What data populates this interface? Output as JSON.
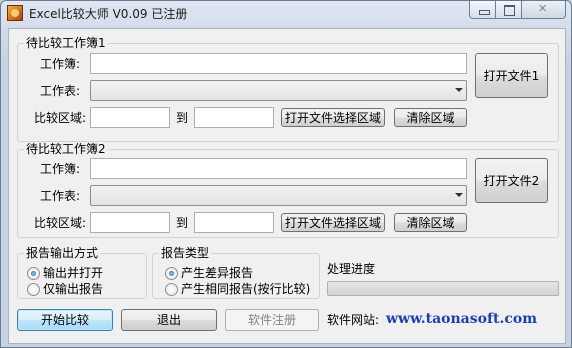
{
  "window": {
    "title": "Excel比较大师 V0.09 已注册"
  },
  "workbook1": {
    "group_label": "待比较工作簿1",
    "workbook_label": "工作簿:",
    "workbook_value": "",
    "sheet_label": "工作表:",
    "sheet_value": "",
    "range_label": "比较区域:",
    "range_from": "",
    "to_label": "到",
    "range_to": "",
    "open_select_range_button": "打开文件选择区域",
    "clear_range_button": "清除区域",
    "open_file_button": "打开文件1"
  },
  "workbook2": {
    "group_label": "待比较工作簿2",
    "workbook_label": "工作簿:",
    "workbook_value": "",
    "sheet_label": "工作表:",
    "sheet_value": "",
    "range_label": "比较区域:",
    "range_from": "",
    "to_label": "到",
    "range_to": "",
    "open_select_range_button": "打开文件选择区域",
    "clear_range_button": "清除区域",
    "open_file_button": "打开文件2"
  },
  "report_output": {
    "group_label": "报告输出方式",
    "options": [
      {
        "label": "输出并打开",
        "selected": true
      },
      {
        "label": "仅输出报告",
        "selected": false
      }
    ]
  },
  "report_type": {
    "group_label": "报告类型",
    "options": [
      {
        "label": "产生差异报告",
        "selected": true
      },
      {
        "label": "产生相同报告(按行比较)",
        "selected": false
      }
    ]
  },
  "progress": {
    "label": "处理进度",
    "value": 0
  },
  "footer": {
    "start_button": "开始比较",
    "exit_button": "退出",
    "register_button": "软件注册",
    "website_label": "软件网站:",
    "website_url": "www.taonasoft.com"
  }
}
